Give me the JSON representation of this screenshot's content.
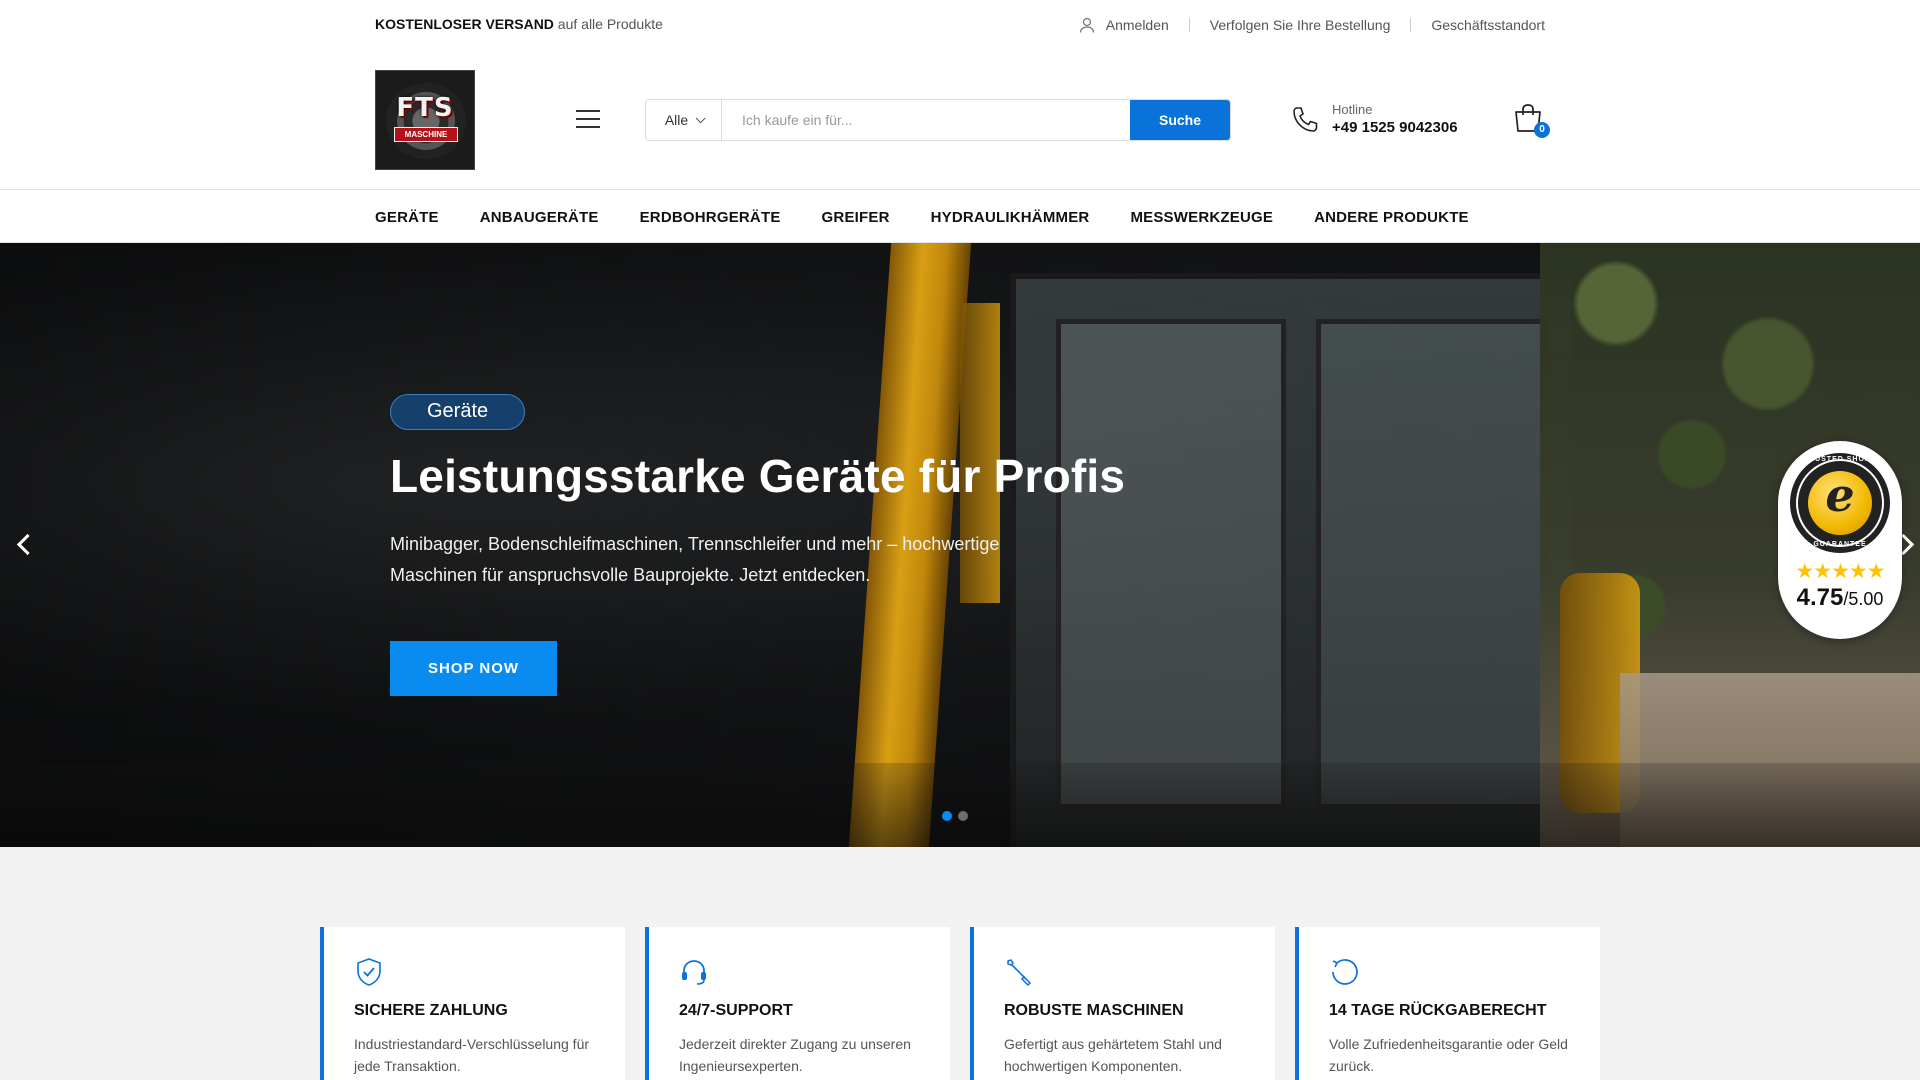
{
  "topbar": {
    "promo_bold": "KOSTENLOSER VERSAND",
    "promo_rest": " auf alle Produkte",
    "links": [
      "Anmelden",
      "Verfolgen Sie Ihre Bestellung",
      "Geschäftsstandort"
    ]
  },
  "header": {
    "logo_text": "FTS",
    "logo_subtext": "MASCHINE",
    "search": {
      "category": "Alle",
      "placeholder": "Ich kaufe ein für...",
      "button": "Suche"
    },
    "hotline_label": "Hotline",
    "hotline_number": "+49 1525 9042306",
    "cart_count": "0"
  },
  "nav": [
    "GERÄTE",
    "ANBAUGERÄTE",
    "ERDBOHRGERÄTE",
    "GREIFER",
    "HYDRAULIKHÄMMER",
    "MESSWERKZEUGE",
    "ANDERE PRODUKTE"
  ],
  "hero": {
    "tag": "Geräte",
    "title": "Leistungsstarke Geräte für Profis",
    "text": "Minibagger, Bodenschleifmaschinen, Trennschleifer und mehr – hochwertige Maschinen für anspruchsvolle Bauprojekte. Jetzt entdecken.",
    "button": "SHOP NOW",
    "slides": 2,
    "active_slide": 1
  },
  "trusted_shops": {
    "ring_top": "TRUSTED SHOPS",
    "ring_bottom": "GUARANTEE",
    "stars": "★★★★★",
    "score": "4.75",
    "max": "/5.00",
    "star_color": "#ffc400"
  },
  "features": [
    {
      "icon": "shield-check-icon",
      "title": "SICHERE ZAHLUNG",
      "text": "Industriestandard-Verschlüsselung für jede Transaktion."
    },
    {
      "icon": "headset-icon",
      "title": "24/7-SUPPORT",
      "text": "Jederzeit direkter Zugang zu unseren Ingenieursexperten."
    },
    {
      "icon": "wrench-icon",
      "title": "ROBUSTE MASCHINEN",
      "text": "Gefertigt aus gehärtetem Stahl und hochwertigen Komponenten."
    },
    {
      "icon": "refresh-icon",
      "title": "14 TAGE RÜCKGABERECHT",
      "text": "Volle Zufriedenheitsgarantie oder Geld zurück."
    }
  ],
  "colors": {
    "accent": "#0a73d9",
    "button_blue": "#0a8bf0",
    "pill": "#15406b"
  }
}
